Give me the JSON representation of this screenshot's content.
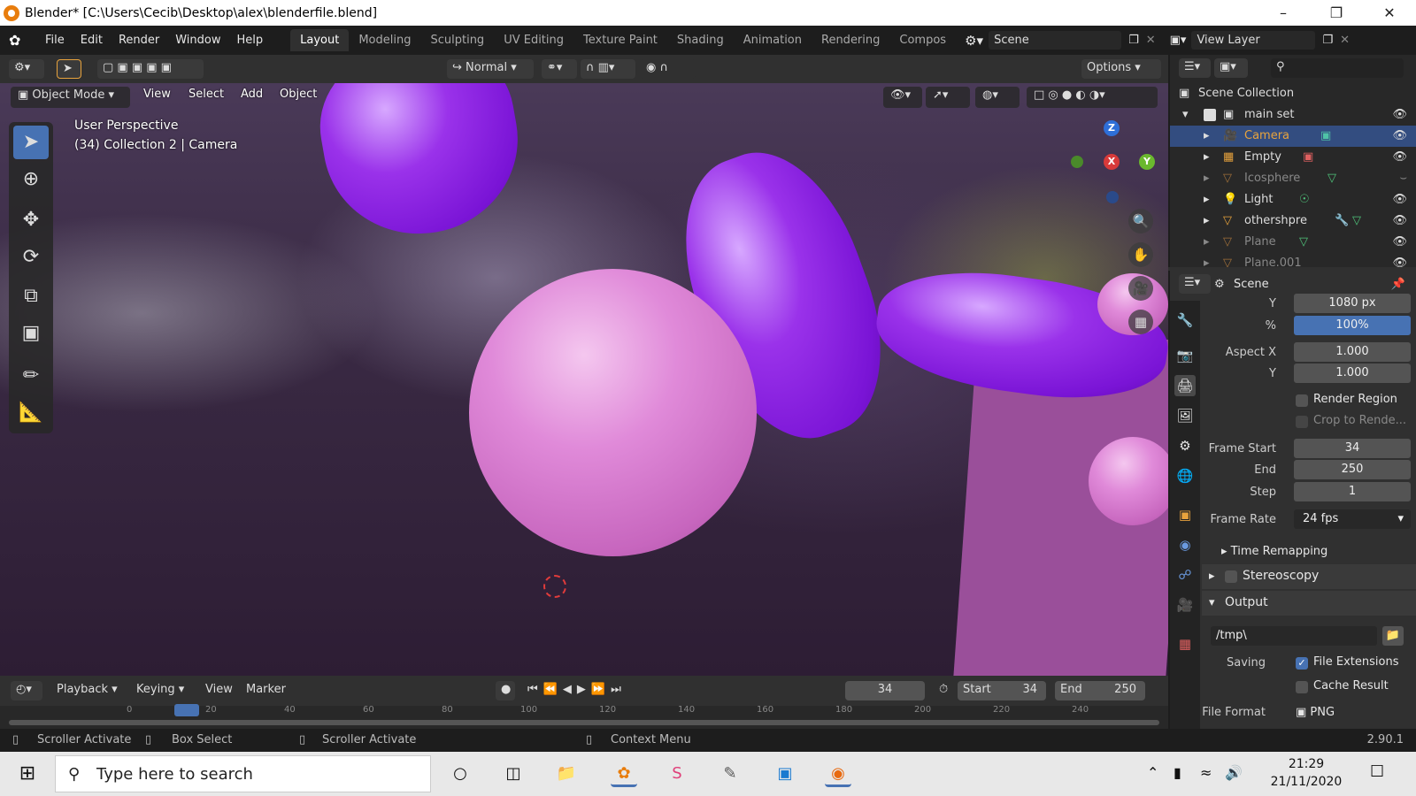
{
  "window": {
    "title": "Blender* [C:\\Users\\Cecib\\Desktop\\alex\\blenderfile.blend]"
  },
  "menubar": {
    "menus": [
      "File",
      "Edit",
      "Render",
      "Window",
      "Help"
    ],
    "workspaces": [
      "Layout",
      "Modeling",
      "Sculpting",
      "UV Editing",
      "Texture Paint",
      "Shading",
      "Animation",
      "Rendering",
      "Compos"
    ],
    "scene": "Scene",
    "view_layer": "View Layer"
  },
  "tool_header": {
    "orientation": "Normal",
    "options": "Options"
  },
  "viewport": {
    "mode": "Object Mode",
    "menus": [
      "View",
      "Select",
      "Add",
      "Object"
    ],
    "overlay_line1": "User Perspective",
    "overlay_line2": "(34) Collection 2 | Camera",
    "gizmo": {
      "z": "Z",
      "x": "X",
      "y": "Y"
    }
  },
  "timeline": {
    "menus": [
      "Playback",
      "Keying",
      "View",
      "Marker"
    ],
    "current_frame": "34",
    "start_label": "Start",
    "start": "34",
    "end_label": "End",
    "end": "250",
    "ruler": [
      "0",
      "20",
      "40",
      "60",
      "80",
      "100",
      "120",
      "140",
      "160",
      "180",
      "200",
      "220",
      "240"
    ]
  },
  "statusbar": {
    "items": [
      "Scroller Activate",
      "Box Select",
      "Scroller Activate",
      "Context Menu"
    ],
    "version": "2.90.1"
  },
  "outliner": {
    "root": "Scene Collection",
    "collection": "main set",
    "items": [
      {
        "name": "Camera",
        "selected": true,
        "dim": false
      },
      {
        "name": "Empty",
        "selected": false,
        "dim": false
      },
      {
        "name": "Icosphere",
        "selected": false,
        "dim": true
      },
      {
        "name": "Light",
        "selected": false,
        "dim": false
      },
      {
        "name": "othershpre",
        "selected": false,
        "dim": false
      },
      {
        "name": "Plane",
        "selected": false,
        "dim": true
      },
      {
        "name": "Plane.001",
        "selected": false,
        "dim": true
      }
    ]
  },
  "properties": {
    "context": "Scene",
    "res_y_label": "Y",
    "res_y": "1080 px",
    "pct_label": "%",
    "pct": "100%",
    "aspect_x_label": "Aspect X",
    "aspect_x": "1.000",
    "aspect_y_label": "Y",
    "aspect_y": "1.000",
    "render_region": "Render Region",
    "crop": "Crop to Rende...",
    "frame_start_label": "Frame Start",
    "frame_start": "34",
    "end_label": "End",
    "end": "250",
    "step_label": "Step",
    "step": "1",
    "frame_rate_label": "Frame Rate",
    "frame_rate": "24 fps",
    "time_remapping": "Time Remapping",
    "stereoscopy": "Stereoscopy",
    "output": "Output",
    "output_path": "/tmp\\",
    "saving_label": "Saving",
    "file_extensions": "File Extensions",
    "cache_result": "Cache Result",
    "file_format_label": "File Format",
    "file_format": "PNG"
  },
  "taskbar": {
    "search_placeholder": "Type here to search",
    "time": "21:29",
    "date": "21/11/2020"
  },
  "colors": {
    "accent": "#4772b3",
    "selection": "#334d80",
    "blender_orange": "#e87d0d"
  }
}
